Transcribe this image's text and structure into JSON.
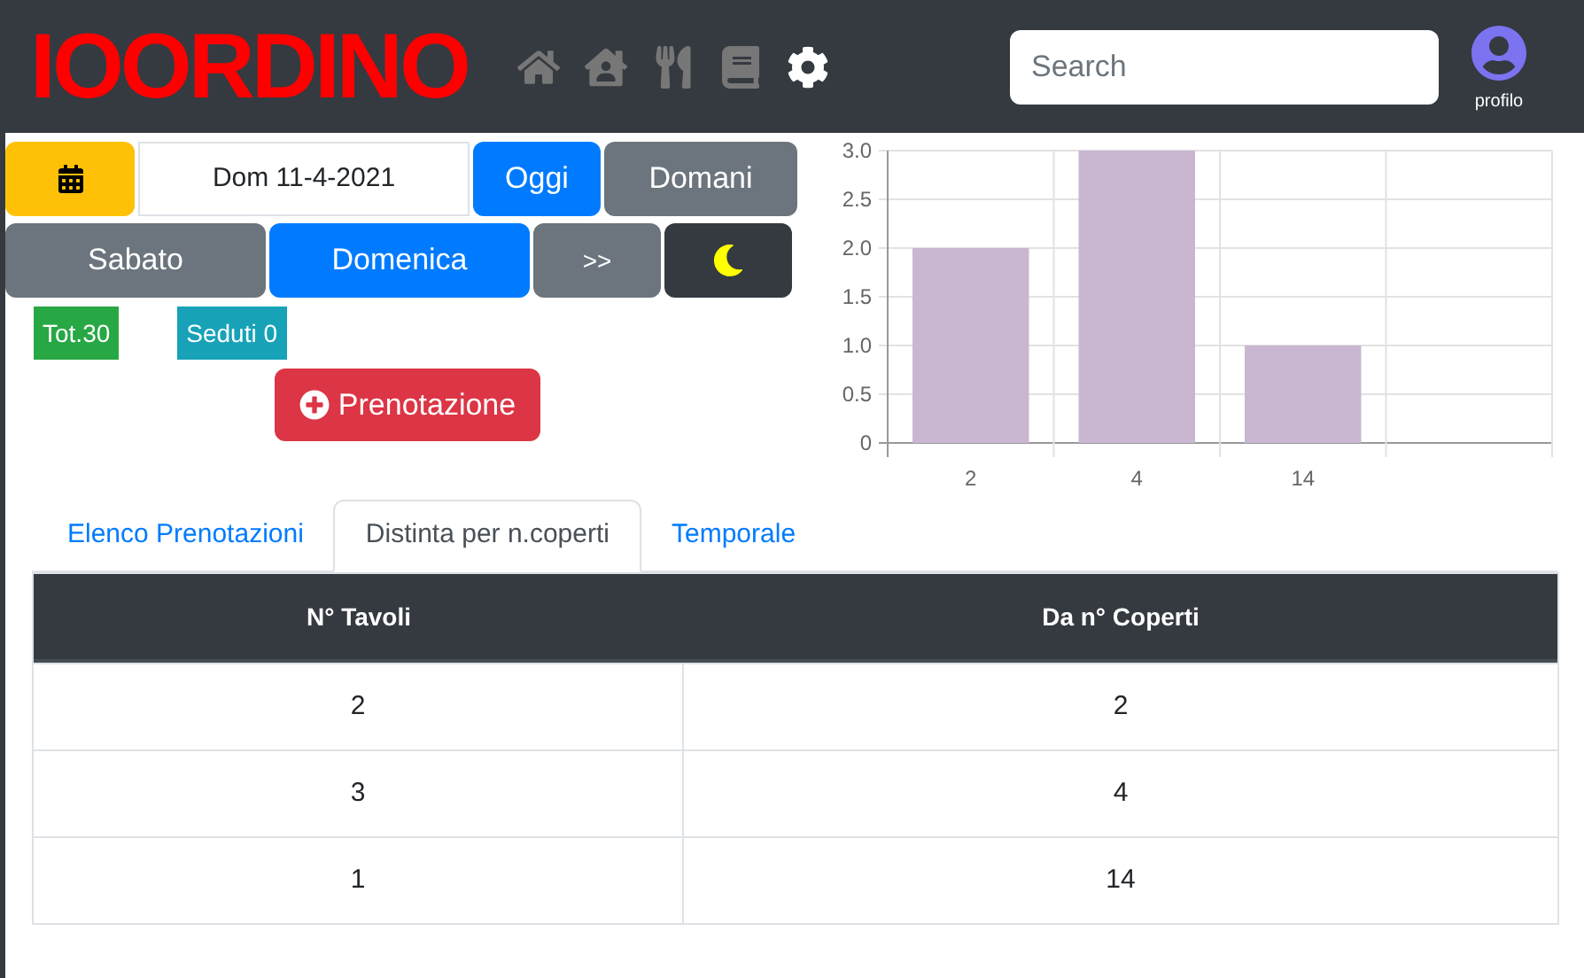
{
  "header": {
    "logo": "IOORDINO",
    "nav": [
      {
        "kind": "home",
        "selected": false
      },
      {
        "kind": "house-user",
        "selected": false
      },
      {
        "kind": "utensils",
        "selected": false
      },
      {
        "kind": "book",
        "selected": false
      },
      {
        "kind": "settings",
        "selected": true
      }
    ],
    "search": {
      "placeholder": "Search"
    },
    "profile": {
      "label": "profilo"
    }
  },
  "date_bar": {
    "date": "Dom 11-4-2021",
    "buttons": [
      {
        "label": "Oggi",
        "selected": true
      },
      {
        "label": "Domani",
        "selected": false
      }
    ]
  },
  "day_bar": {
    "buttons": [
      {
        "label": "Sabato",
        "selected": false
      },
      {
        "label": "Domenica",
        "selected": true
      },
      {
        "label": ">>",
        "selected": false
      }
    ]
  },
  "badges": [
    {
      "label": "Tot.30",
      "color": "#28a745"
    },
    {
      "label": "Seduti 0",
      "color": "#17a2b8"
    }
  ],
  "new_button": {
    "label": "Prenotazione"
  },
  "chart": {
    "chart_data": {
      "type": "bar",
      "categories": [
        "2",
        "4",
        "14"
      ],
      "series": [
        {
          "color": "#c9b7d1",
          "values": [
            2,
            3,
            1
          ]
        }
      ],
      "ylim": [
        0,
        3
      ],
      "grid": true,
      "yticks": [
        {
          "value": 0,
          "label": "0"
        },
        {
          "value": 0.5,
          "label": "0.5"
        },
        {
          "value": 1,
          "label": "1.0"
        },
        {
          "value": 1.5,
          "label": "1.5"
        },
        {
          "value": 2,
          "label": "2.0"
        },
        {
          "value": 2.5,
          "label": "2.5"
        },
        {
          "value": 3,
          "label": "3.0"
        }
      ]
    }
  },
  "tabs": [
    {
      "label": "Elenco Prenotazioni",
      "selected": false
    },
    {
      "label": "Distinta per n.coperti",
      "selected": true
    },
    {
      "label": "Temporale",
      "selected": false
    }
  ],
  "table": {
    "columns": [
      "N° Tavoli",
      "Da n° Coperti"
    ],
    "rows": [
      [
        "2",
        "2"
      ],
      [
        "3",
        "4"
      ],
      [
        "1",
        "14"
      ]
    ]
  }
}
